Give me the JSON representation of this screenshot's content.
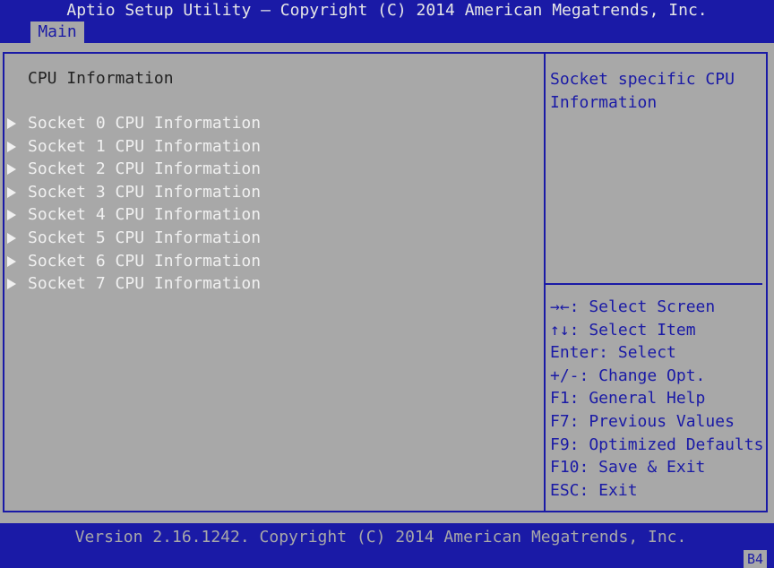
{
  "header": {
    "title": "Aptio Setup Utility – Copyright (C) 2014 American Megatrends, Inc.",
    "tab": "Main"
  },
  "main": {
    "section_title": "CPU Information",
    "items": [
      {
        "label": "Socket 0 CPU Information"
      },
      {
        "label": "Socket 1 CPU Information"
      },
      {
        "label": "Socket 2 CPU Information"
      },
      {
        "label": "Socket 3 CPU Information"
      },
      {
        "label": "Socket 4 CPU Information"
      },
      {
        "label": "Socket 5 CPU Information"
      },
      {
        "label": "Socket 6 CPU Information"
      },
      {
        "label": "Socket 7 CPU Information"
      }
    ]
  },
  "help": {
    "text": "Socket specific CPU Information"
  },
  "keys": [
    "→←: Select Screen",
    "↑↓: Select Item",
    "Enter: Select",
    "+/-: Change Opt.",
    "F1: General Help",
    "F7: Previous Values",
    "F9: Optimized Defaults",
    "F10: Save & Exit",
    "ESC: Exit"
  ],
  "footer": {
    "version": "Version 2.16.1242. Copyright (C) 2014 American Megatrends, Inc.",
    "badge": "B4"
  },
  "colors": {
    "bios_blue": "#1a1aa6",
    "background_gray": "#a8a8a8",
    "highlight_white": "#f0f0f0"
  }
}
